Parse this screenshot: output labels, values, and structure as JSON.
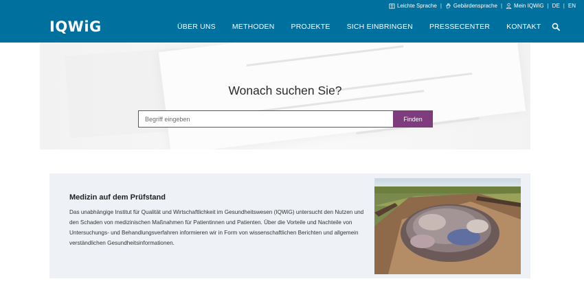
{
  "topbar": {
    "items": [
      {
        "label": "Leichte Sprache",
        "icon": "easy-language-icon"
      },
      {
        "label": "Gebärdensprache",
        "icon": "sign-language-icon"
      },
      {
        "label": "Mein IQWiG",
        "icon": "user-icon"
      }
    ],
    "lang_de": "DE",
    "lang_en": "EN",
    "separator": "|"
  },
  "logo": {
    "text": "IQWiG"
  },
  "nav": {
    "items": [
      "ÜBER UNS",
      "METHODEN",
      "PROJEKTE",
      "SICH EINBRINGEN",
      "PRESSECENTER",
      "KONTAKT"
    ]
  },
  "hero": {
    "title": "Wonach suchen Sie?",
    "search_placeholder": "Begriff eingeben",
    "find_label": "Finden"
  },
  "teaser": {
    "title": "Medizin auf dem Prüfstand",
    "text": "Das unabhängige Institut für Qualität und Wirtschaftlichkeit im Gesundheitswesen (IQWiG) untersucht den Nutzen und den Schaden von medizinischen Maßnahmen für Patientinnen und Patienten. Über die Vorteile und Nachteile von Untersuchungs- und Behandlungsverfahren informieren wir in Form von wissenschaftlichen Berichten und allgemein verständlichen Gesundheitsinformationen."
  },
  "colors": {
    "header": "#00709e",
    "accent_purple": "#7e3b7e",
    "teaser_bg": "#eef1f5"
  }
}
